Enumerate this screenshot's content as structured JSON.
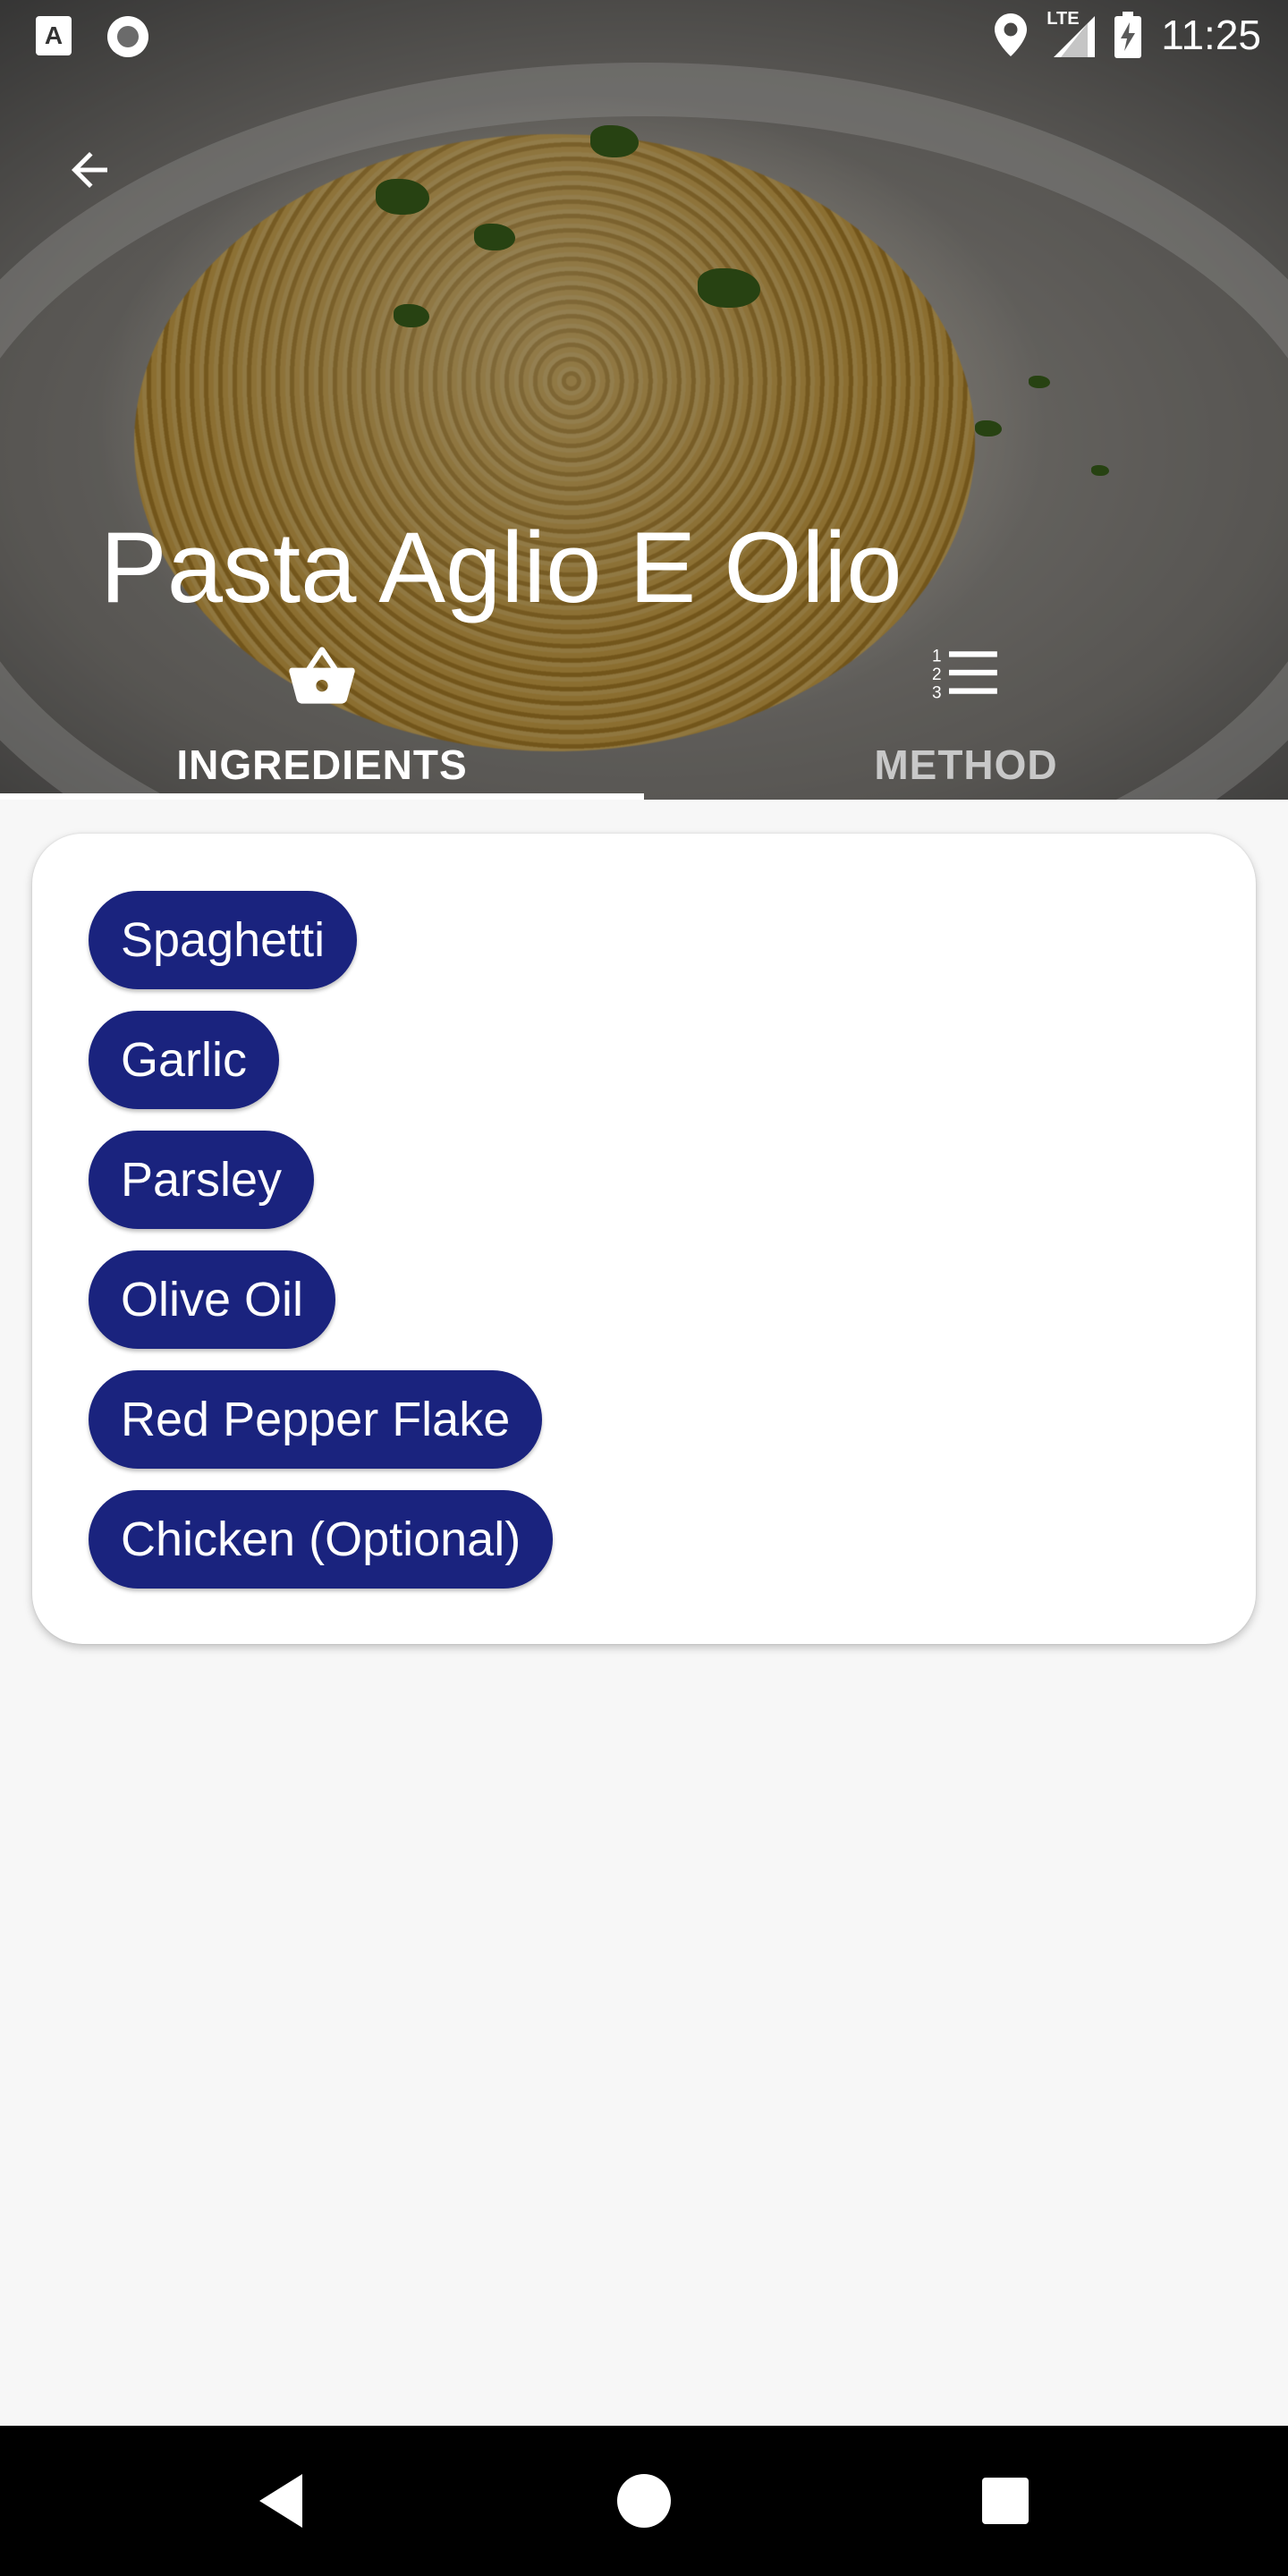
{
  "status_bar": {
    "time": "11:25",
    "network": "LTE",
    "icons": [
      "app-a-icon",
      "record-icon",
      "location-icon",
      "signal-icon",
      "battery-charging-icon"
    ]
  },
  "header": {
    "back_icon": "arrow-back-icon",
    "title": "Pasta Aglio E Olio",
    "tabs": [
      {
        "label": "INGREDIENTS",
        "icon": "basket-icon",
        "active": true
      },
      {
        "label": "METHOD",
        "icon": "numbered-list-icon",
        "active": false
      }
    ]
  },
  "ingredients": [
    "Spaghetti",
    "Garlic",
    "Parsley",
    "Olive Oil",
    "Red Pepper Flake",
    "Chicken (Optional)"
  ],
  "colors": {
    "chip": "#1a237e",
    "background": "#f7f7f7",
    "card": "#ffffff"
  },
  "nav_bar": {
    "buttons": [
      "back-triangle-icon",
      "home-circle-icon",
      "recents-square-icon"
    ]
  }
}
